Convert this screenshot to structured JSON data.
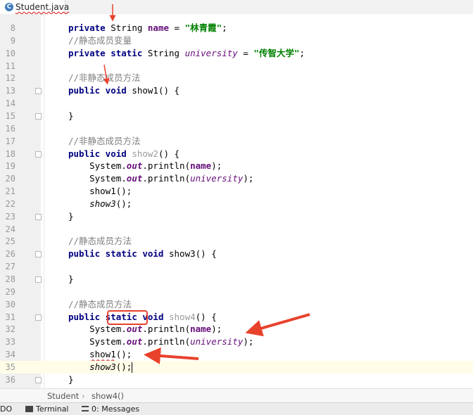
{
  "tab": {
    "icon_letter": "C",
    "label": "Student.java"
  },
  "code_lines": [
    {
      "n": "8",
      "fold": false,
      "tokens": [
        {
          "t": "private ",
          "c": "kw"
        },
        {
          "t": "String ",
          "c": ""
        },
        {
          "t": "name",
          "c": "fld"
        },
        {
          "t": " = ",
          "c": ""
        },
        {
          "t": "\"林青霞\"",
          "c": "str"
        },
        {
          "t": ";",
          "c": ""
        }
      ]
    },
    {
      "n": "9",
      "fold": false,
      "tokens": [
        {
          "t": "//静态成员变量",
          "c": "cm"
        }
      ]
    },
    {
      "n": "10",
      "fold": false,
      "tokens": [
        {
          "t": "private static ",
          "c": "kw"
        },
        {
          "t": "String ",
          "c": ""
        },
        {
          "t": "university",
          "c": "sfld"
        },
        {
          "t": " = ",
          "c": ""
        },
        {
          "t": "\"传智大学\"",
          "c": "str"
        },
        {
          "t": ";",
          "c": ""
        }
      ]
    },
    {
      "n": "11",
      "fold": false,
      "tokens": []
    },
    {
      "n": "12",
      "fold": false,
      "tokens": [
        {
          "t": "//非静态成员方法",
          "c": "cm"
        }
      ]
    },
    {
      "n": "13",
      "fold": true,
      "tokens": [
        {
          "t": "public void ",
          "c": "kw"
        },
        {
          "t": "show1() {",
          "c": ""
        }
      ]
    },
    {
      "n": "14",
      "fold": false,
      "tokens": []
    },
    {
      "n": "15",
      "fold": true,
      "tokens": [
        {
          "t": "}",
          "c": ""
        }
      ]
    },
    {
      "n": "16",
      "fold": false,
      "tokens": []
    },
    {
      "n": "17",
      "fold": false,
      "tokens": [
        {
          "t": "//非静态成员方法",
          "c": "cm"
        }
      ]
    },
    {
      "n": "18",
      "fold": true,
      "tokens": [
        {
          "t": "public void ",
          "c": "kw"
        },
        {
          "t": "show2",
          "c": "unused"
        },
        {
          "t": "() {",
          "c": ""
        }
      ]
    },
    {
      "n": "19",
      "fold": false,
      "tokens": [
        {
          "t": "    System.",
          "c": ""
        },
        {
          "t": "out",
          "c": "statfld"
        },
        {
          "t": ".println(",
          "c": ""
        },
        {
          "t": "name",
          "c": "fld"
        },
        {
          "t": ");",
          "c": ""
        }
      ]
    },
    {
      "n": "20",
      "fold": false,
      "tokens": [
        {
          "t": "    System.",
          "c": ""
        },
        {
          "t": "out",
          "c": "statfld"
        },
        {
          "t": ".println(",
          "c": ""
        },
        {
          "t": "university",
          "c": "sfld"
        },
        {
          "t": ");",
          "c": ""
        }
      ]
    },
    {
      "n": "21",
      "fold": false,
      "tokens": [
        {
          "t": "    show1();",
          "c": ""
        }
      ]
    },
    {
      "n": "22",
      "fold": false,
      "tokens": [
        {
          "t": "    ",
          "c": ""
        },
        {
          "t": "show3",
          "c": "stat"
        },
        {
          "t": "();",
          "c": ""
        }
      ]
    },
    {
      "n": "23",
      "fold": true,
      "tokens": [
        {
          "t": "}",
          "c": ""
        }
      ]
    },
    {
      "n": "24",
      "fold": false,
      "tokens": []
    },
    {
      "n": "25",
      "fold": false,
      "tokens": [
        {
          "t": "//静态成员方法",
          "c": "cm"
        }
      ]
    },
    {
      "n": "26",
      "fold": true,
      "tokens": [
        {
          "t": "public static void ",
          "c": "kw"
        },
        {
          "t": "show3() {",
          "c": ""
        }
      ]
    },
    {
      "n": "27",
      "fold": false,
      "tokens": []
    },
    {
      "n": "28",
      "fold": true,
      "tokens": [
        {
          "t": "}",
          "c": ""
        }
      ]
    },
    {
      "n": "29",
      "fold": false,
      "tokens": []
    },
    {
      "n": "30",
      "fold": false,
      "tokens": [
        {
          "t": "//静态成员方法",
          "c": "cm"
        }
      ]
    },
    {
      "n": "31",
      "fold": true,
      "tokens": [
        {
          "t": "public ",
          "c": "kw"
        },
        {
          "t": "static",
          "c": "kw"
        },
        {
          "t": " void ",
          "c": "kw"
        },
        {
          "t": "show4",
          "c": "unused"
        },
        {
          "t": "() {",
          "c": ""
        }
      ]
    },
    {
      "n": "32",
      "fold": false,
      "tokens": [
        {
          "t": "    System.",
          "c": ""
        },
        {
          "t": "out",
          "c": "statfld"
        },
        {
          "t": ".println(",
          "c": ""
        },
        {
          "t": "name",
          "c": "fld"
        },
        {
          "t": ");",
          "c": ""
        }
      ]
    },
    {
      "n": "33",
      "fold": false,
      "tokens": [
        {
          "t": "    System.",
          "c": ""
        },
        {
          "t": "out",
          "c": "statfld"
        },
        {
          "t": ".println(",
          "c": ""
        },
        {
          "t": "university",
          "c": "sfld"
        },
        {
          "t": ");",
          "c": ""
        }
      ]
    },
    {
      "n": "34",
      "fold": false,
      "tokens": [
        {
          "t": "    ",
          "c": ""
        },
        {
          "t": "show1",
          "c": "squig"
        },
        {
          "t": "();",
          "c": ""
        }
      ]
    },
    {
      "n": "35",
      "fold": false,
      "current": true,
      "tokens": [
        {
          "t": "    ",
          "c": ""
        },
        {
          "t": "show3",
          "c": "stat"
        },
        {
          "t": "();",
          "c": ""
        }
      ]
    },
    {
      "n": "36",
      "fold": true,
      "tokens": [
        {
          "t": "}",
          "c": ""
        }
      ]
    }
  ],
  "breadcrumb": {
    "class_name": "Student",
    "separator": "›",
    "method_name": "show4()"
  },
  "bottom_toolbar": {
    "todo_label": "DO",
    "terminal_label": "Terminal",
    "messages_label": "0: Messages"
  },
  "colors": {
    "keyword": "#000080",
    "string": "#008000",
    "comment": "#808080",
    "field": "#660e7a",
    "annotation_red": "#e8412c"
  }
}
